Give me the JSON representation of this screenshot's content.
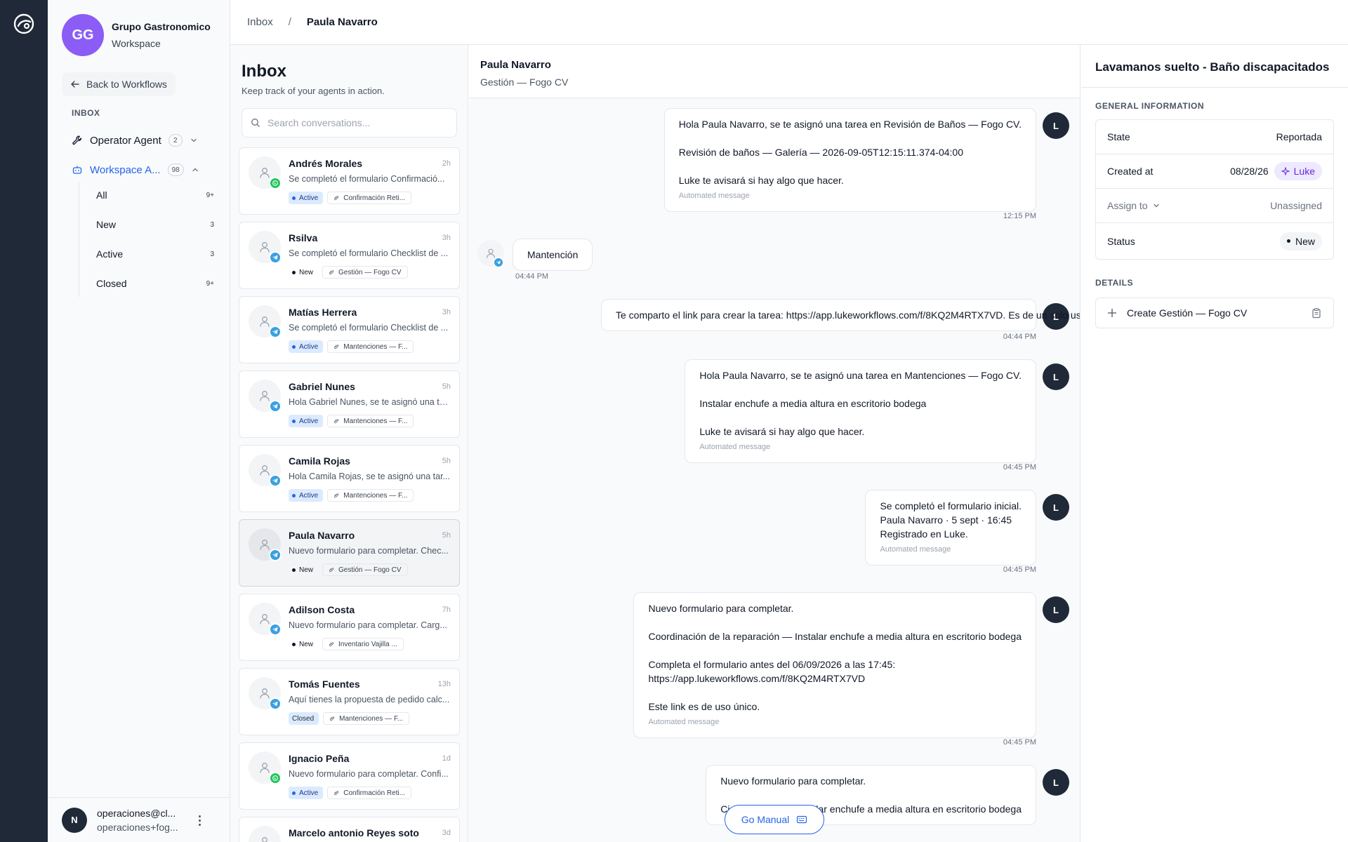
{
  "workspace": {
    "initials": "GG",
    "name": "Grupo Gastronomico",
    "subtitle": "Workspace"
  },
  "sidebar": {
    "back_label": "Back to Workflows",
    "section_label": "INBOX",
    "agents": [
      {
        "label": "Operator Agent",
        "count": "2",
        "color": "#111827"
      },
      {
        "label": "Workspace A...",
        "count": "98",
        "color": "#2563eb"
      }
    ],
    "filters": [
      {
        "label": "All",
        "count": "9+"
      },
      {
        "label": "New",
        "count": "3"
      },
      {
        "label": "Active",
        "count": "3"
      },
      {
        "label": "Closed",
        "count": "9+"
      }
    ]
  },
  "user": {
    "initial": "N",
    "email": "operaciones@cl...",
    "email2": "operaciones+fog..."
  },
  "breadcrumb": {
    "root": "Inbox",
    "separator": "/",
    "current": "Paula Navarro"
  },
  "inbox": {
    "title": "Inbox",
    "subtitle": "Keep track of your agents in action.",
    "search_placeholder": "Search conversations...",
    "conversations": [
      {
        "name": "Andrés Morales",
        "time": "2h",
        "preview": "Se completó el formulario Confirmació...",
        "status": "Active",
        "workflow": "Confirmación Reti...",
        "channel": "whatsapp"
      },
      {
        "name": "Rsilva",
        "time": "3h",
        "preview": "Se completó el formulario Checklist de ...",
        "status": "New",
        "workflow": "Gestión — Fogo CV",
        "channel": "telegram"
      },
      {
        "name": "Matías Herrera",
        "time": "3h",
        "preview": "Se completó el formulario Checklist de ...",
        "status": "Active",
        "workflow": "Mantenciones — F...",
        "channel": "telegram"
      },
      {
        "name": "Gabriel Nunes",
        "time": "5h",
        "preview": "Hola Gabriel Nunes, se te asignó una ta...",
        "status": "Active",
        "workflow": "Mantenciones — F...",
        "channel": "telegram"
      },
      {
        "name": "Camila Rojas",
        "time": "5h",
        "preview": "Hola Camila Rojas, se te asignó una tar...",
        "status": "Active",
        "workflow": "Mantenciones — F...",
        "channel": "telegram"
      },
      {
        "name": "Paula Navarro",
        "time": "5h",
        "preview": "Nuevo formulario para completar. Chec...",
        "status": "New",
        "workflow": "Gestión — Fogo CV",
        "channel": "telegram",
        "selected": true
      },
      {
        "name": "Adilson Costa",
        "time": "7h",
        "preview": "Nuevo formulario para completar. Carg...",
        "status": "New",
        "workflow": "Inventario Vajilla ...",
        "channel": "telegram"
      },
      {
        "name": "Tomás Fuentes",
        "time": "13h",
        "preview": "Aquí tienes la propuesta de pedido calc...",
        "status": "Closed",
        "workflow": "Mantenciones — F...",
        "channel": "telegram"
      },
      {
        "name": "Ignacio Peña",
        "time": "1d",
        "preview": "Nuevo formulario para completar. Confi...",
        "status": "Active",
        "workflow": "Confirmación Reti...",
        "channel": "whatsapp"
      },
      {
        "name": "Marcelo antonio Reyes soto",
        "time": "3d",
        "preview": "",
        "status": "",
        "workflow": "",
        "channel": "none"
      }
    ]
  },
  "chat": {
    "contact_name": "Paula Navarro",
    "contact_sub": "Gestión — Fogo CV",
    "messages": [
      {
        "dir": "out",
        "lines": [
          "Hola Paula Navarro, se te asignó una tarea en Revisión de Baños — Fogo CV.",
          "",
          "Revisión de baños — Galería — 2026-09-05T12:15:11.374-04:00",
          "",
          "Luke te avisará si hay algo que hacer."
        ],
        "automated": "Automated message",
        "time": "12:15 PM",
        "avatar": "L"
      },
      {
        "dir": "in",
        "lines": [
          "Mantención"
        ],
        "automated": "",
        "time": "04:44 PM",
        "avatar": ""
      },
      {
        "dir": "out",
        "lines": [
          "Te comparto el link para crear la tarea: https://app.lukeworkflows.com/f/8KQ2M4RTX7VD. Es de un solo uso."
        ],
        "automated": "",
        "time": "04:44 PM",
        "avatar": "L"
      },
      {
        "dir": "out",
        "lines": [
          "Hola Paula Navarro, se te asignó una tarea en Mantenciones — Fogo CV.",
          "",
          "Instalar enchufe a media altura en escritorio bodega",
          "",
          "Luke te avisará si hay algo que hacer."
        ],
        "automated": "Automated message",
        "time": "04:45 PM",
        "avatar": "L"
      },
      {
        "dir": "out",
        "lines": [
          "Se completó el formulario inicial.",
          "Paula Navarro · 5 sept · 16:45",
          "Registrado en Luke."
        ],
        "automated": "Automated message",
        "time": "04:45 PM",
        "avatar": "L"
      },
      {
        "dir": "out",
        "lines": [
          "Nuevo formulario para completar.",
          "",
          "Coordinación de la reparación — Instalar enchufe a media altura en escritorio bodega",
          "",
          "Completa el formulario antes del 06/09/2026 a las 17:45:",
          "https://app.lukeworkflows.com/f/8KQ2M4RTX7VD",
          "",
          "Este link es de uso único."
        ],
        "automated": "Automated message",
        "time": "04:45 PM",
        "avatar": "L"
      },
      {
        "dir": "out",
        "lines": [
          "Nuevo formulario para completar.",
          "",
          "Cierre directo — Instalar enchufe a media altura en escritorio bodega"
        ],
        "automated": "",
        "time": "",
        "avatar": "L"
      }
    ],
    "go_manual": "Go Manual"
  },
  "details": {
    "title": "Lavamanos suelto - Baño discapacitados",
    "general_label": "GENERAL INFORMATION",
    "state_label": "State",
    "state_value": "Reportada",
    "created_label": "Created at",
    "created_value": "08/28/26",
    "created_by": "Luke",
    "assign_label": "Assign to",
    "assign_value": "Unassigned",
    "status_label": "Status",
    "status_value": "New",
    "details_label": "DETAILS",
    "create_label": "Create Gestión — Fogo CV"
  },
  "colors": {
    "rail": "#1f2937",
    "accent": "#2563eb",
    "workspace_avatar": "#8b5cf6",
    "telegram": "#3ba0e0",
    "whatsapp": "#22c55e",
    "luke_chip": "#ede9fe"
  }
}
